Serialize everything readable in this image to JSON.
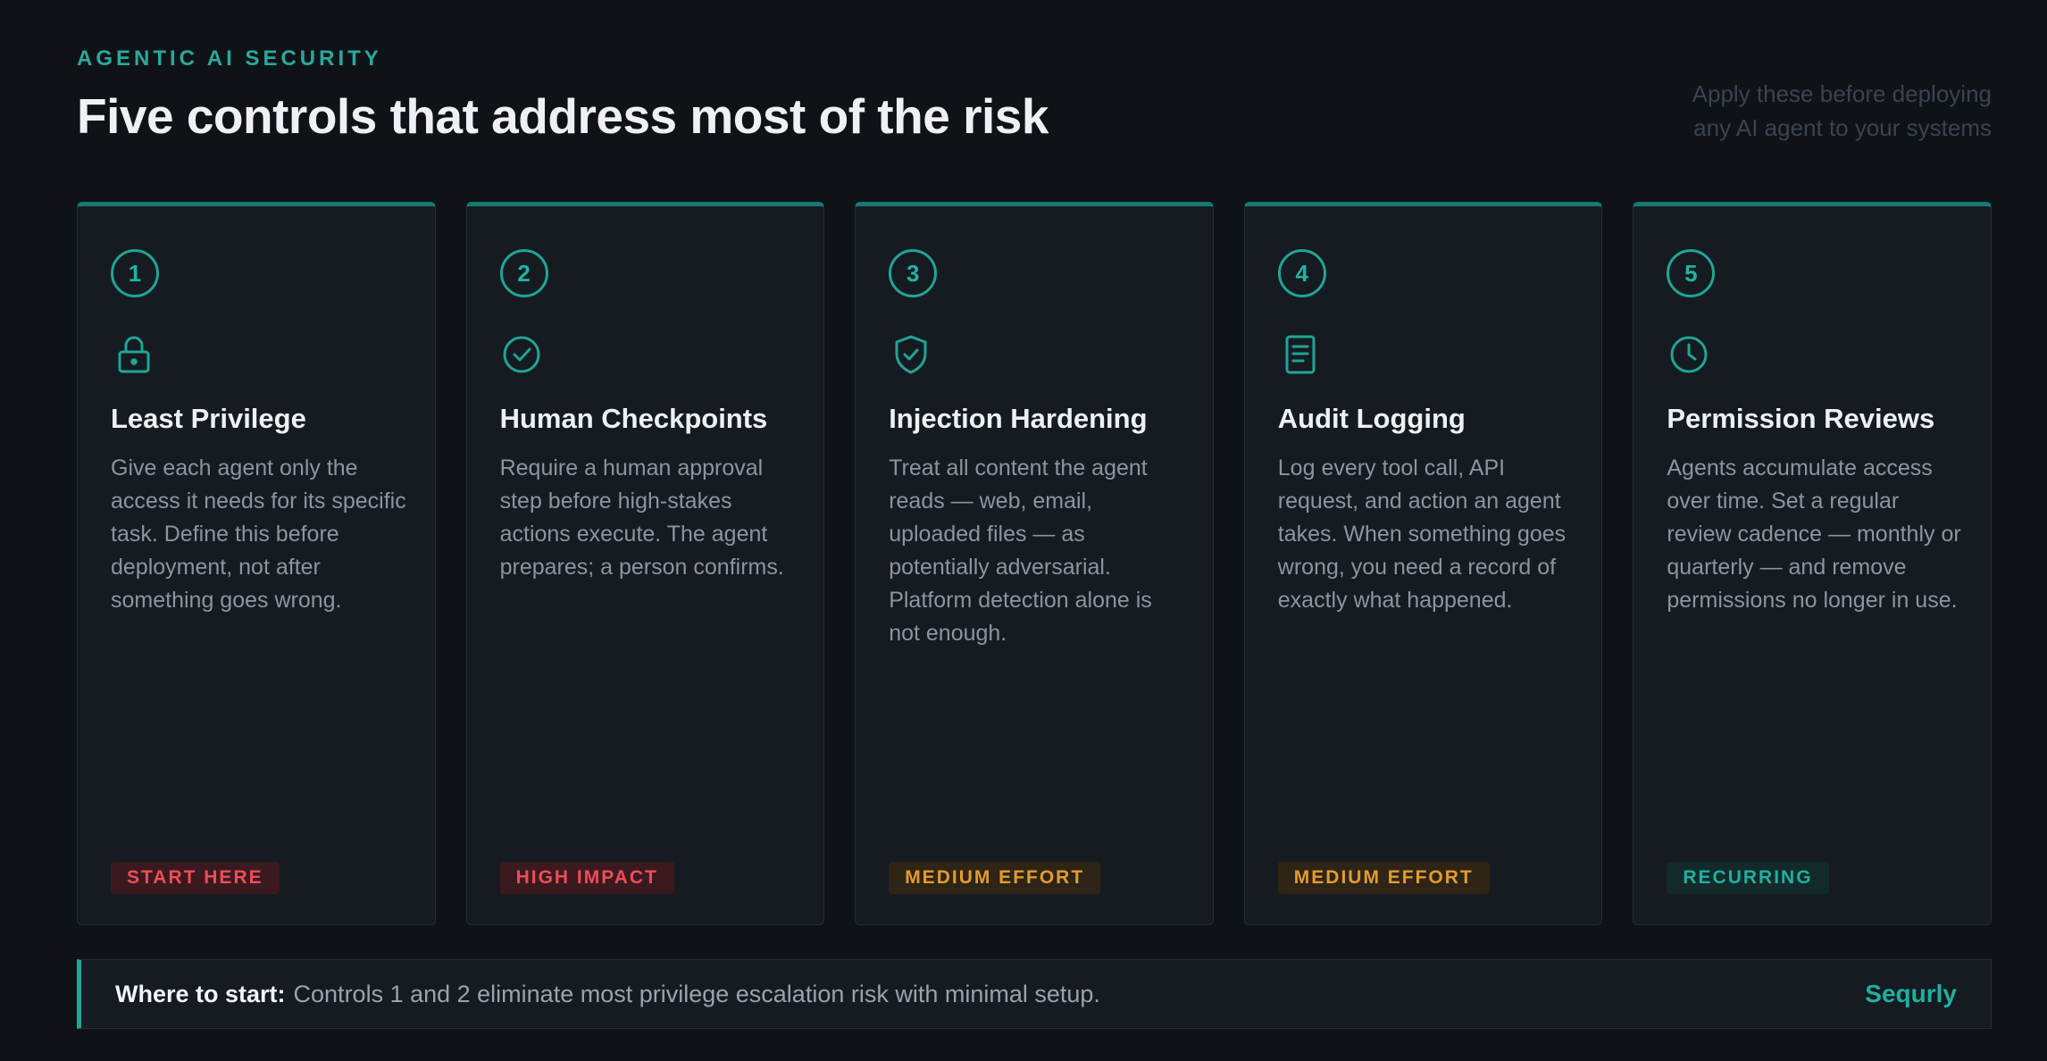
{
  "header": {
    "eyebrow": "AGENTIC AI SECURITY",
    "title": "Five controls that address most of the risk",
    "note_line1": "Apply these before deploying",
    "note_line2": "any AI agent to your systems"
  },
  "colors": {
    "accent": "#1fa596",
    "red_badge": "#ef4d58",
    "amber_badge": "#e39b2f",
    "teal_badge": "#1fb09f"
  },
  "cards": [
    {
      "number": "1",
      "icon": "lock-icon",
      "title": "Least Privilege",
      "description": "Give each agent only the access it needs for its specific task. Define this before deployment, not after something goes wrong.",
      "badge": "START HERE"
    },
    {
      "number": "2",
      "icon": "check-circle-icon",
      "title": "Human Checkpoints",
      "description": "Require a human approval step before high-stakes actions execute. The agent prepares; a person confirms.",
      "badge": "HIGH IMPACT"
    },
    {
      "number": "3",
      "icon": "shield-check-icon",
      "title": "Injection Hardening",
      "description": "Treat all content the agent reads — web, email, uploaded files — as potentially adversarial. Platform detection alone is not enough.",
      "badge": "MEDIUM EFFORT"
    },
    {
      "number": "4",
      "icon": "document-icon",
      "title": "Audit Logging",
      "description": "Log every tool call, API request, and action an agent takes. When something goes wrong, you need a record of exactly what happened.",
      "badge": "MEDIUM EFFORT"
    },
    {
      "number": "5",
      "icon": "clock-icon",
      "title": "Permission Reviews",
      "description": "Agents accumulate access over time. Set a regular review cadence — monthly or quarterly — and remove permissions no longer in use.",
      "badge": "RECURRING"
    }
  ],
  "footer": {
    "lead": "Where to start:",
    "message": "Controls 1 and 2 eliminate most privilege escalation risk with minimal setup.",
    "brand": "Sequrly"
  }
}
